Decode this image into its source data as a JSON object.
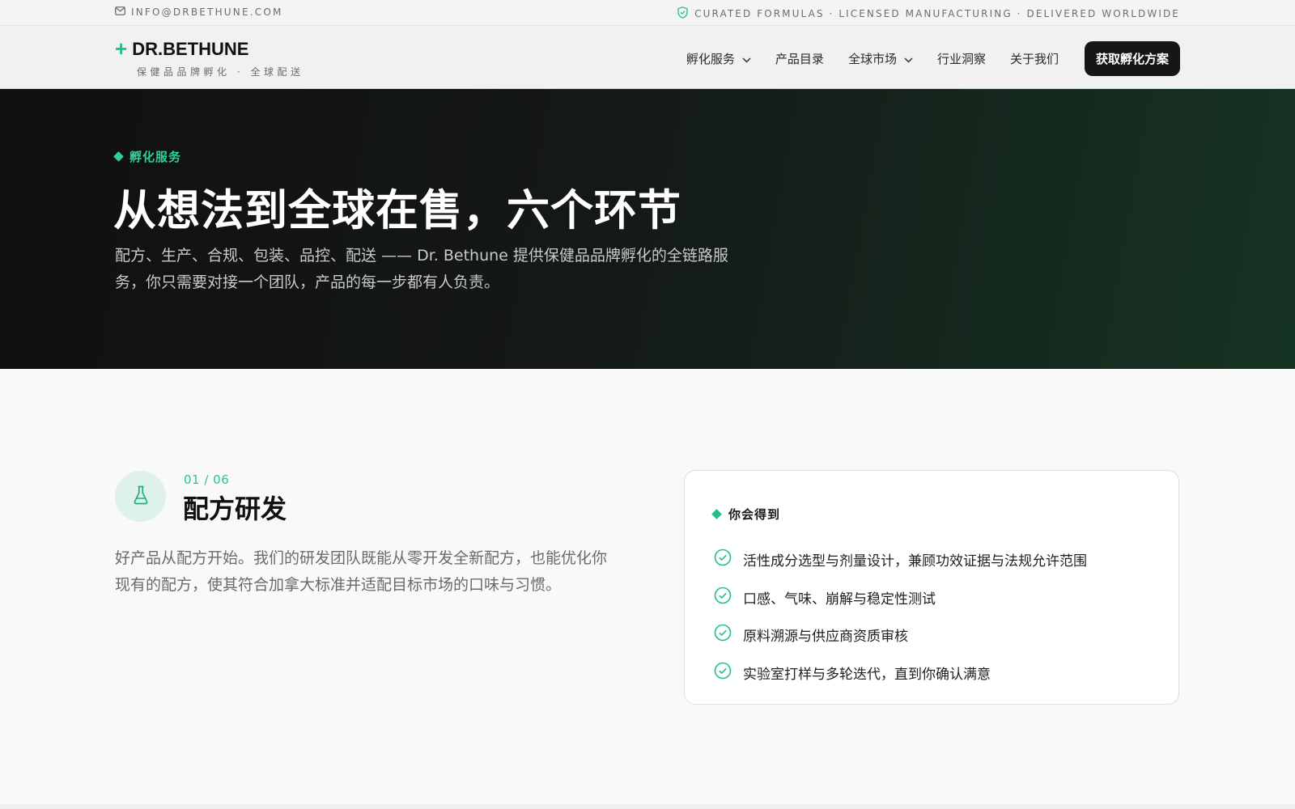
{
  "topbar": {
    "email_icon": "mail-icon",
    "email": "INFO@DRBETHUNE.COM",
    "tagline_icon": "shield-check-icon",
    "tagline": "CURATED FORMULAS · LICENSED MANUFACTURING · DELIVERED WORLDWIDE"
  },
  "header": {
    "logo_icon": "plus-icon",
    "logo_name": "DR.BETHUNE",
    "logo_sub": "保健品品牌孵化 · 全球配送",
    "nav": [
      {
        "label": "孵化服务",
        "has_dropdown": true
      },
      {
        "label": "产品目录",
        "has_dropdown": false
      },
      {
        "label": "全球市场",
        "has_dropdown": true
      },
      {
        "label": "行业洞察",
        "has_dropdown": false
      },
      {
        "label": "关于我们",
        "has_dropdown": false
      }
    ],
    "cta_label": "获取孵化方案"
  },
  "hero": {
    "eyebrow": "孵化服务",
    "title": "从想法到全球在售，六个环节",
    "description": "配方、生产、合规、包装、品控、配送 —— Dr. Bethune 提供保健品品牌孵化的全链路服务，你只需要对接一个团队，产品的每一步都有人负责。"
  },
  "step": {
    "icon": "flask-icon",
    "counter": "01 / 06",
    "title": "配方研发",
    "body": "好产品从配方开始。我们的研发团队既能从零开发全新配方，也能优化你现有的配方，使其符合加拿大标准并适配目标市场的口味与习惯。"
  },
  "deliverables": {
    "title": "你会得到",
    "item_icon": "check-circle-icon",
    "items": [
      "活性成分选型与剂量设计，兼顾功效证据与法规允许范围",
      "口感、气味、崩解与稳定性测试",
      "原料溯源与供应商资质审核",
      "实验室打样与多轮迭代，直到你确认满意"
    ]
  },
  "colors": {
    "accent": "#22c08a",
    "hero_bg": "#121513",
    "cta_bg": "#161616"
  }
}
